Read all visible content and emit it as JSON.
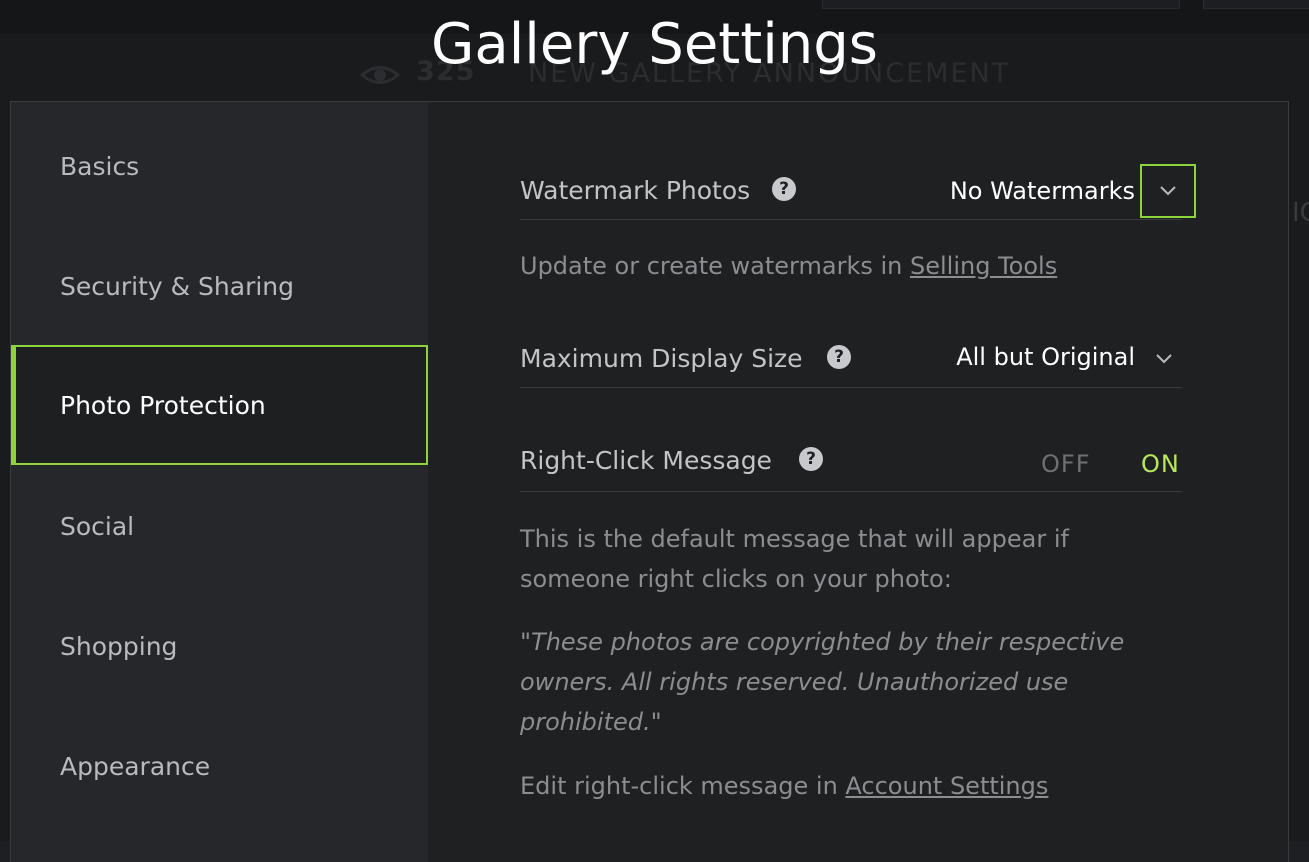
{
  "page": {
    "title": "Gallery Settings"
  },
  "background": {
    "view_count": "325",
    "caption": "NEW GALLERY ANNOUNCEMENT",
    "edge_text": "IC"
  },
  "sidebar": {
    "items": [
      {
        "label": "Basics"
      },
      {
        "label": "Security & Sharing"
      },
      {
        "label": "Photo Protection",
        "active": true
      },
      {
        "label": "Social"
      },
      {
        "label": "Shopping"
      },
      {
        "label": "Appearance"
      }
    ]
  },
  "content": {
    "watermark": {
      "label": "Watermark Photos",
      "help": "?",
      "value": "No Watermarks",
      "hint_prefix": "Update or create watermarks in ",
      "hint_link": "Selling Tools"
    },
    "display_size": {
      "label": "Maximum Display Size",
      "help": "?",
      "value": "All but Original"
    },
    "right_click": {
      "label": "Right-Click Message",
      "help": "?",
      "off_label": "OFF",
      "on_label": "ON",
      "enabled": true,
      "description": "This is the default message that will appear if someone right clicks on your photo:",
      "message": "\"These photos are copyrighted by their respective owners. All rights reserved. Unauthorized use prohibited.\"",
      "edit_prefix": "Edit right-click message in ",
      "edit_link": "Account Settings"
    }
  },
  "colors": {
    "accent": "#8dd33a",
    "off_text": "#6f7074"
  }
}
